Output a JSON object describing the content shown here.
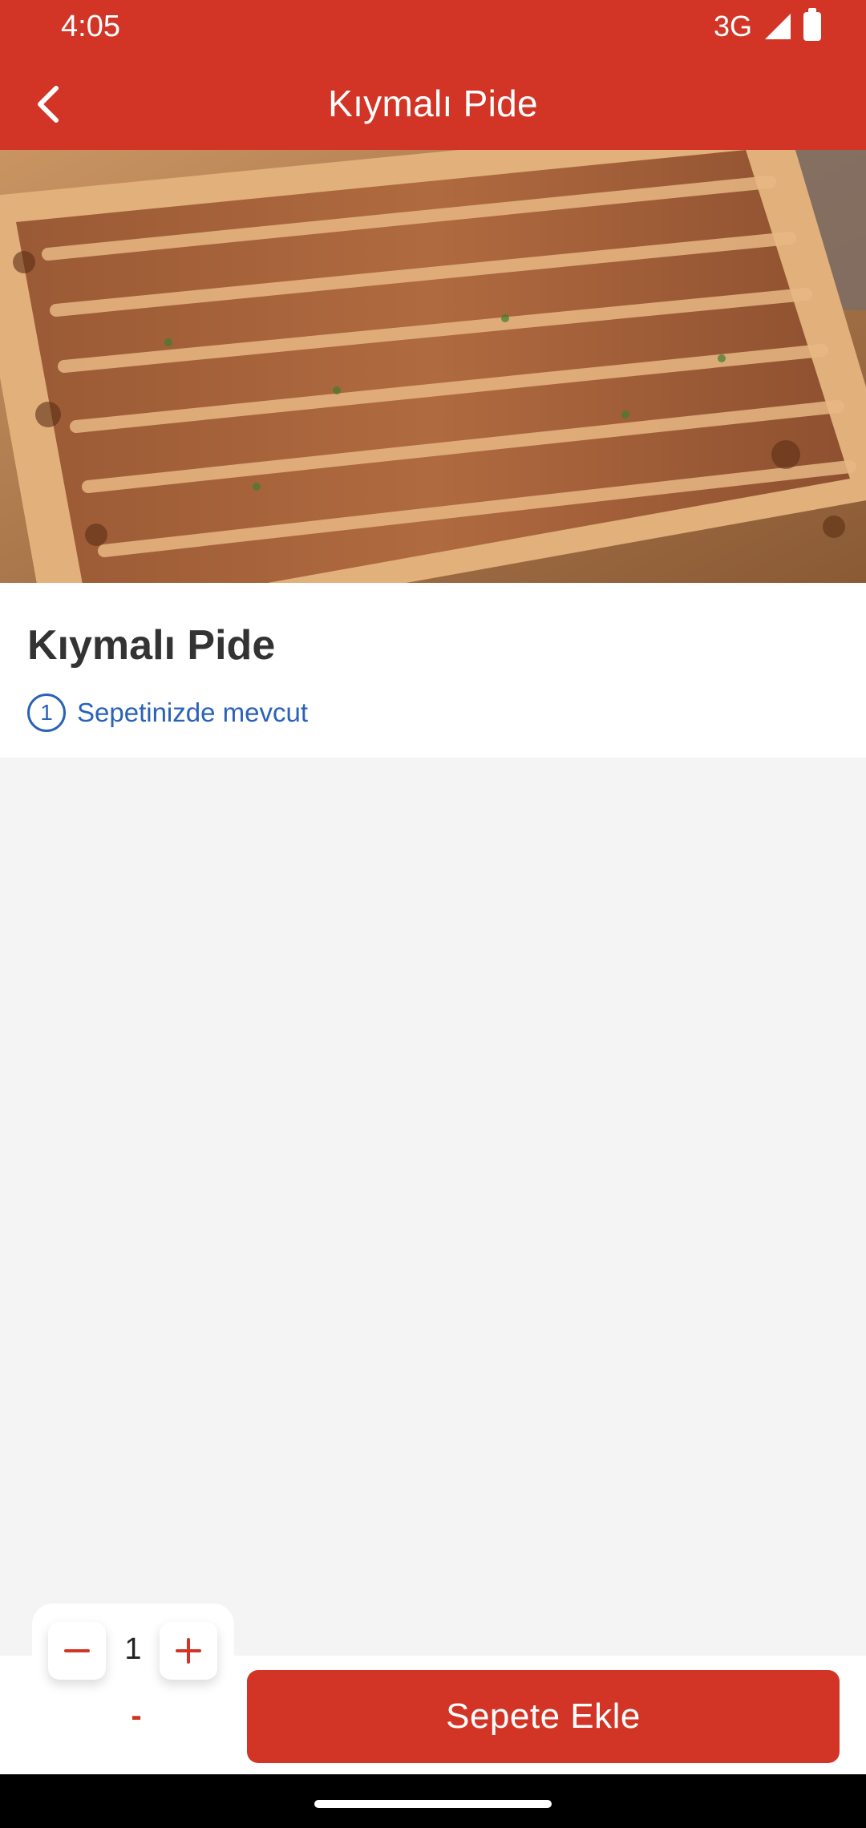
{
  "status_bar": {
    "time": "4:05",
    "network": "3G",
    "icons": [
      "signal-icon",
      "battery-icon"
    ]
  },
  "app_bar": {
    "title": "Kıymalı Pide",
    "back_icon": "chevron-left-icon"
  },
  "hero": {
    "image": "kiymali-pide-photo"
  },
  "product": {
    "title": "Kıymalı Pide",
    "cart_count": "1",
    "cart_status": "Sepetinizde mevcut"
  },
  "quantity": {
    "value": "1",
    "sub_label": "-",
    "minus_icon": "minus-icon",
    "plus_icon": "plus-icon"
  },
  "actions": {
    "add_to_cart": "Sepete Ekle"
  },
  "colors": {
    "primary": "#d23526",
    "link": "#2a62b8",
    "background": "#f4f4f4"
  }
}
